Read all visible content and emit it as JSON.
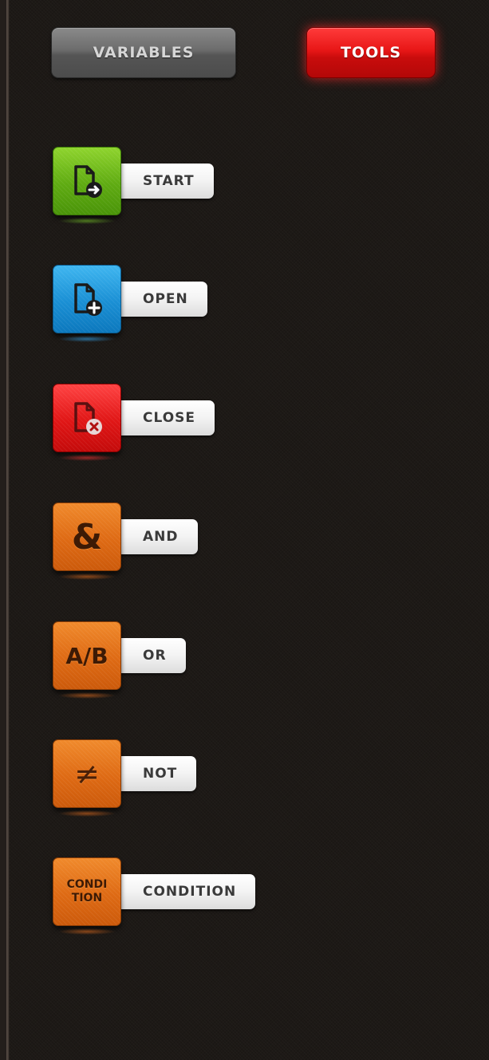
{
  "tabs": {
    "variables_label": "VARIABLES",
    "tools_label": "TOOLS",
    "active": "TOOLS"
  },
  "colors": {
    "background": "#1d1916",
    "tools_tab": "#e81717",
    "variables_tab": "#6c6c6c",
    "start_icon": "#5fab12",
    "open_icon": "#1a8fd4",
    "close_icon": "#e01616",
    "logic_icon": "#de6a14"
  },
  "tools": [
    {
      "id": "start",
      "label": "START",
      "icon": "document-arrow-icon",
      "color": "green"
    },
    {
      "id": "open",
      "label": "OPEN",
      "icon": "document-plus-icon",
      "color": "blue"
    },
    {
      "id": "close",
      "label": "CLOSE",
      "icon": "document-x-icon",
      "color": "red"
    },
    {
      "id": "and",
      "label": "AND",
      "icon": "ampersand-icon",
      "glyph": "&",
      "color": "orange"
    },
    {
      "id": "or",
      "label": "OR",
      "icon": "a-slash-b-icon",
      "glyph": "A/B",
      "color": "orange"
    },
    {
      "id": "not",
      "label": "NOT",
      "icon": "not-equal-icon",
      "glyph": "≠",
      "color": "orange"
    },
    {
      "id": "condition",
      "label": "CONDITION",
      "icon": "condition-icon",
      "glyph_line1": "CONDI",
      "glyph_line2": "TION",
      "color": "orange"
    }
  ]
}
